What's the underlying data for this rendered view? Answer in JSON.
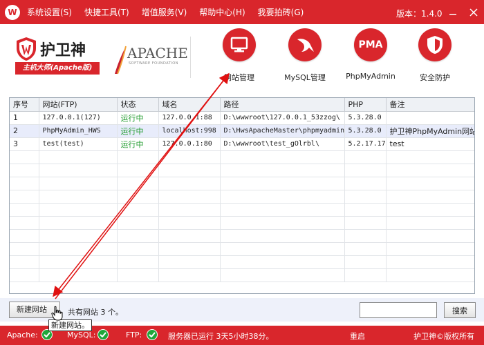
{
  "titlebar": {
    "menu": [
      "系统设置(S)",
      "快捷工具(T)",
      "增值服务(V)",
      "帮助中心(H)",
      "我要拍砖(G)"
    ],
    "version": "版本：1.4.0"
  },
  "brand": {
    "name": "护卫神",
    "subtitle": "主机大师(Apache版)",
    "apache_logo_text": "APACHE",
    "apache_sub": "SOFTWARE FOUNDATION"
  },
  "tools": [
    {
      "label": "网站管理",
      "icon": "monitor-icon"
    },
    {
      "label": "MySQL管理",
      "icon": "mysql-dolphin-icon"
    },
    {
      "label": "PhpMyAdmin",
      "icon": "pma-icon",
      "icon_text": "PMA"
    },
    {
      "label": "安全防护",
      "icon": "shield-icon"
    }
  ],
  "table": {
    "columns": [
      "序号",
      "网站(FTP)",
      "状态",
      "域名",
      "路径",
      "PHP",
      "备注"
    ],
    "rows": [
      [
        "1",
        "127.0.0.1(127)",
        "运行中",
        "127.0.0.1:88",
        "D:\\wwwroot\\127.0.0.1_53zzog\\",
        "5.3.28.0",
        ""
      ],
      [
        "2",
        "PhpMyAdmin_HWS",
        "运行中",
        "localhost:998",
        "D:\\HwsApacheMaster\\phpmyadmin",
        "5.3.28.0",
        "护卫神PhpMyAdmin网站"
      ],
      [
        "3",
        "test(test)",
        "运行中",
        "127.0.0.1:80",
        "D:\\wwwroot\\test_gOlrbl\\",
        "5.2.17.17",
        "test"
      ]
    ],
    "selected_row": 1
  },
  "bottom": {
    "new_site_label": "新建网站",
    "site_count": "共有网站 3 个。",
    "search_value": "",
    "search_label": "搜索",
    "tooltip": "新建网站。"
  },
  "statusbar": {
    "apache_label": "Apache:",
    "mysql_label": "MySQL:",
    "ftp_label": "FTP:",
    "uptime": "服务器已运行 3天5小时38分。",
    "restart": "重启",
    "copyright": "护卫神©版权所有"
  },
  "colors": {
    "brand_red": "#d9262c",
    "status_green": "#1c9a2a",
    "ok_green": "#1fa63a",
    "selected_row": "#e8ecfb"
  }
}
